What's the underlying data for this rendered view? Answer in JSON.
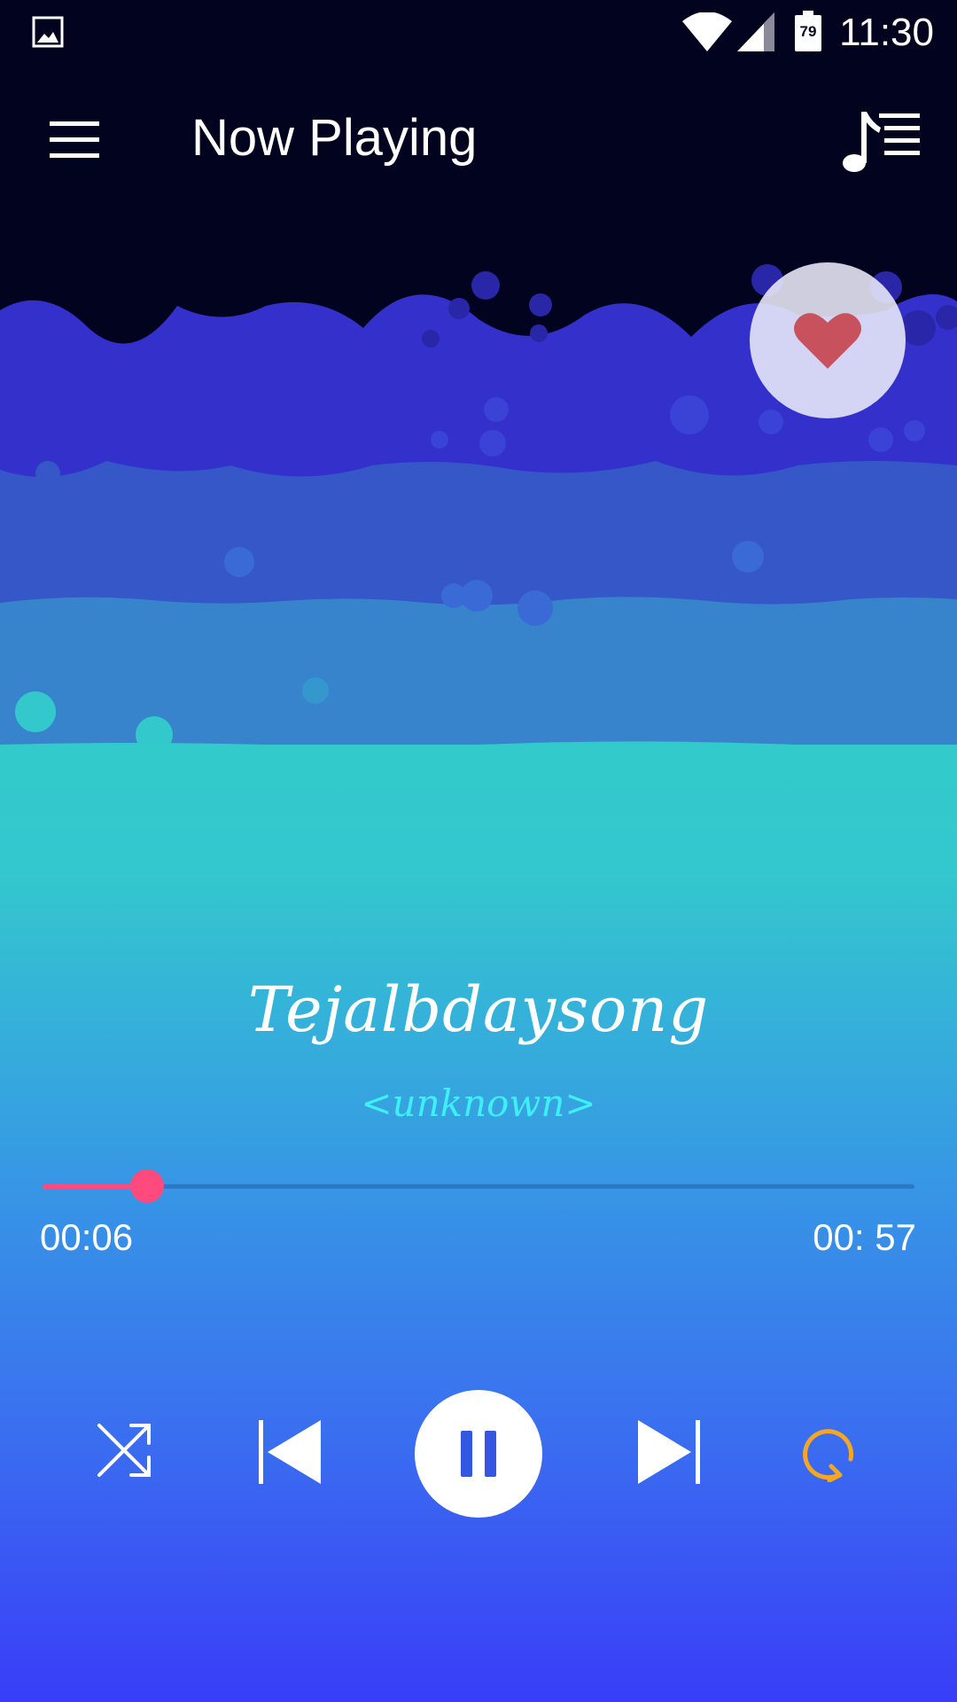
{
  "status_bar": {
    "time": "11:30",
    "battery_level": "79",
    "icons": [
      "gallery-icon",
      "wifi-icon",
      "signal-icon",
      "battery-icon"
    ]
  },
  "app_bar": {
    "title": "Now Playing",
    "menu_icon": "hamburger-menu-icon",
    "playlist_icon": "music-playlist-icon"
  },
  "song": {
    "title": "Tejalbdaysong",
    "artist": "<unknown>"
  },
  "progress": {
    "elapsed": "00:06",
    "total": "00: 57",
    "fraction": 0.12
  },
  "controls": {
    "shuffle_icon": "shuffle-icon",
    "previous_icon": "skip-previous-icon",
    "play_pause_icon": "pause-icon",
    "next_icon": "skip-next-icon",
    "repeat_icon": "repeat-icon"
  },
  "colors": {
    "background_dark": "#02031f",
    "wave_1": "#3330cc",
    "wave_2": "#3557c8",
    "wave_3": "#3783cc",
    "wave_4": "#33c8cc",
    "accent_pink": "#ff4a7d",
    "artist_cyan": "#3ef0f5",
    "repeat_orange": "#f5a623",
    "heart_red": "#c8515e"
  }
}
